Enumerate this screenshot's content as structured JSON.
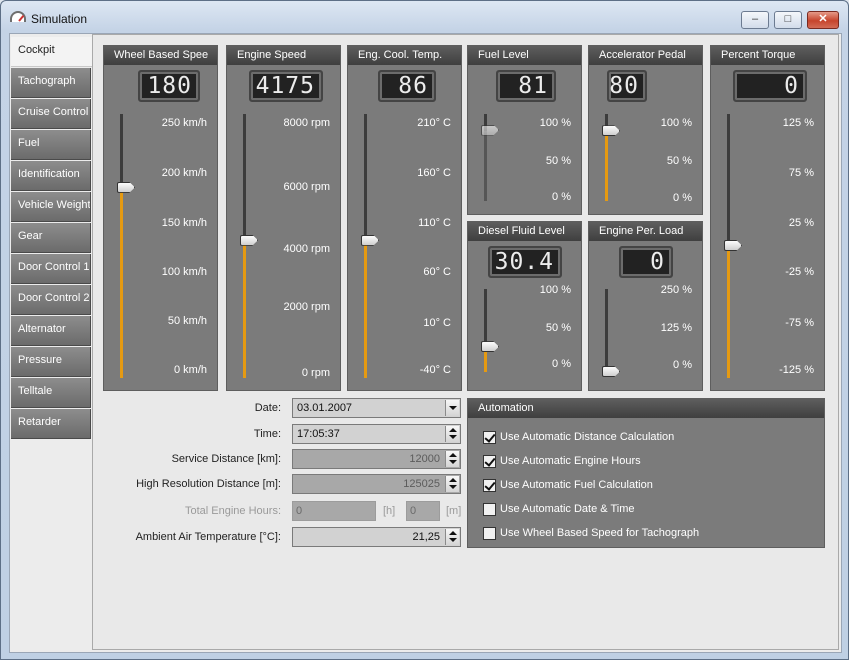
{
  "window": {
    "title": "Simulation",
    "min": "–",
    "max": "□",
    "close": "✕"
  },
  "tabs": [
    "Cockpit",
    "Tachograph",
    "Cruise Control",
    "Fuel",
    "Identification",
    "Vehicle Weight",
    "Gear",
    "Door Control 1",
    "Door Control 2",
    "Alternator",
    "Pressure",
    "Telltale",
    "Retarder"
  ],
  "active_tab": "Cockpit",
  "gauges": [
    {
      "title": "Wheel Based Spee",
      "display": "180",
      "level": 0.72,
      "ticks": [
        "250 km/h",
        "200 km/h",
        "150 km/h",
        "100 km/h",
        "50 km/h",
        "0 km/h"
      ]
    },
    {
      "title": "Engine Speed",
      "display": "4175",
      "level": 0.52,
      "ticks": [
        "8000 rpm",
        "6000 rpm",
        "4000 rpm",
        "2000 rpm",
        "0 rpm"
      ]
    },
    {
      "title": "Eng. Cool. Temp.",
      "display": "86",
      "level": 0.52,
      "ticks": [
        "210° C",
        "160° C",
        "110° C",
        "60° C",
        "10° C",
        "-40° C"
      ]
    },
    {
      "title": "Fuel Level",
      "display": "81",
      "level": 0.81,
      "ticks": [
        "100 %",
        "50 %",
        "0 %"
      ]
    },
    {
      "title": "Accelerator Pedal",
      "display": "80",
      "level": 0.8,
      "ticks": [
        "100 %",
        "50 %",
        "0 %"
      ]
    },
    {
      "title": "Percent Torque",
      "display": "0",
      "level": 0.5,
      "ticks": [
        "125 %",
        "75 %",
        "25 %",
        "-25 %",
        "-75 %",
        "-125 %"
      ]
    },
    {
      "title": "Diesel Fluid Level",
      "display": "30.4",
      "level": 0.3,
      "ticks": [
        "100 %",
        "50 %",
        "0 %"
      ]
    },
    {
      "title": "Engine Per. Load",
      "display": "0",
      "level": 0.0,
      "ticks": [
        "250 %",
        "125 %",
        "0 %"
      ]
    }
  ],
  "form": {
    "date_label": "Date:",
    "date_value": "03.01.2007",
    "time_label": "Time:",
    "time_value": "17:05:37",
    "service_label": "Service Distance [km]:",
    "service_value": "12000",
    "hires_label": "High Resolution Distance [m]:",
    "hires_value": "125025",
    "engine_hours_label": "Total Engine Hours:",
    "engine_hours_h": "0",
    "unit_h": "[h]",
    "engine_hours_m": "0",
    "unit_m": "[m]",
    "ambient_label": "Ambient Air Temperature [°C]:",
    "ambient_value": "21,25"
  },
  "automation": {
    "title": "Automation",
    "options": [
      {
        "label": "Use Automatic Distance Calculation",
        "checked": true
      },
      {
        "label": "Use Automatic Engine Hours",
        "checked": true
      },
      {
        "label": "Use Automatic Fuel Calculation",
        "checked": true
      },
      {
        "label": "Use Automatic Date & Time",
        "checked": false
      },
      {
        "label": "Use Wheel Based Speed for Tachograph",
        "checked": false
      }
    ]
  },
  "colors": {
    "fill": "#e59a12",
    "panel": "#7b7b7b",
    "header": "#4a4a4a"
  }
}
